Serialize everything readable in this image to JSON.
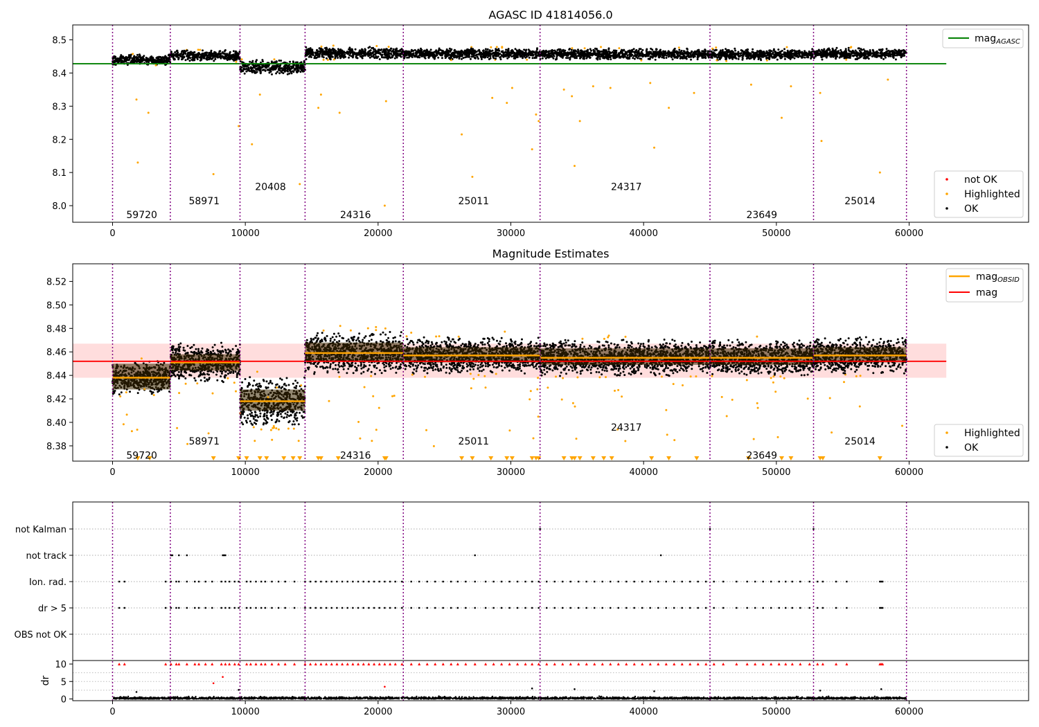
{
  "chart_data": [
    {
      "type": "scatter",
      "title": "AGASC ID 41814056.0",
      "xlabel": "",
      "ylabel": "",
      "xlim": [
        -3000,
        69000
      ],
      "ylim": [
        7.95,
        8.545
      ],
      "xticks": [
        0,
        10000,
        20000,
        30000,
        40000,
        50000,
        60000
      ],
      "yticks": [
        8.0,
        8.1,
        8.2,
        8.3,
        8.4,
        8.5
      ],
      "ytick_labels": [
        "8.0",
        "8.1",
        "8.2",
        "8.3",
        "8.4",
        "8.5"
      ],
      "reference_line": {
        "name": "mag_AGASC",
        "label": "mag",
        "subscript": "AGASC",
        "y": 8.428,
        "x_range": [
          -3000,
          62800
        ],
        "color": "#008000"
      },
      "legend_top": [
        {
          "label": "mag",
          "subscript": "AGASC",
          "color": "#008000",
          "marker": "line"
        }
      ],
      "legend_bottom": [
        {
          "label": "not OK",
          "color": "#ff0000",
          "marker": "dot"
        },
        {
          "label": "Highlighted",
          "color": "#ffa500",
          "marker": "dot"
        },
        {
          "label": "OK",
          "color": "#000000",
          "marker": "dot"
        }
      ],
      "segments": [
        {
          "obsid": "59720",
          "x_start": 0,
          "x_end": 4350,
          "mag_center": 8.44,
          "mag_spread": 0.012,
          "label_x": 2200,
          "label_y": 7.973
        },
        {
          "obsid": "58971",
          "x_start": 4350,
          "x_end": 9600,
          "mag_center": 8.452,
          "mag_spread": 0.013,
          "label_x": 6900,
          "label_y": 8.015
        },
        {
          "obsid": "20408",
          "x_start": 9600,
          "x_end": 14500,
          "mag_center": 8.418,
          "mag_spread": 0.017,
          "label_x": 11900,
          "label_y": 8.058
        },
        {
          "obsid": "24316",
          "x_start": 14500,
          "x_end": 21900,
          "mag_center": 8.46,
          "mag_spread": 0.014,
          "label_x": 18300,
          "label_y": 7.973
        },
        {
          "obsid": "25011",
          "x_start": 21900,
          "x_end": 32200,
          "mag_center": 8.458,
          "mag_spread": 0.013,
          "label_x": 27200,
          "label_y": 8.015
        },
        {
          "obsid": "24317",
          "x_start": 32200,
          "x_end": 45000,
          "mag_center": 8.457,
          "mag_spread": 0.013,
          "label_x": 38700,
          "label_y": 8.058
        },
        {
          "obsid": "23649",
          "x_start": 45000,
          "x_end": 52800,
          "mag_center": 8.456,
          "mag_spread": 0.013,
          "label_x": 48900,
          "label_y": 7.973
        },
        {
          "obsid": "25014",
          "x_start": 52800,
          "x_end": 59800,
          "mag_center": 8.458,
          "mag_spread": 0.013,
          "label_x": 56300,
          "label_y": 8.015
        }
      ],
      "highlighted_outliers": [
        [
          1800,
          8.32
        ],
        [
          1900,
          8.13
        ],
        [
          2700,
          8.28
        ],
        [
          7600,
          8.095
        ],
        [
          9500,
          8.24
        ],
        [
          10500,
          8.185
        ],
        [
          11100,
          8.335
        ],
        [
          14100,
          8.065
        ],
        [
          15500,
          8.295
        ],
        [
          15700,
          8.335
        ],
        [
          17100,
          8.28
        ],
        [
          20600,
          8.315
        ],
        [
          20500,
          8.0
        ],
        [
          26300,
          8.215
        ],
        [
          27100,
          8.087
        ],
        [
          28600,
          8.325
        ],
        [
          29700,
          8.31
        ],
        [
          30100,
          8.355
        ],
        [
          31600,
          8.17
        ],
        [
          31900,
          8.275
        ],
        [
          32100,
          8.255
        ],
        [
          34000,
          8.35
        ],
        [
          34600,
          8.33
        ],
        [
          34800,
          8.12
        ],
        [
          35200,
          8.255
        ],
        [
          36200,
          8.36
        ],
        [
          37500,
          8.355
        ],
        [
          40500,
          8.37
        ],
        [
          40800,
          8.175
        ],
        [
          41900,
          8.295
        ],
        [
          43800,
          8.34
        ],
        [
          48100,
          8.365
        ],
        [
          50400,
          8.265
        ],
        [
          51100,
          8.36
        ],
        [
          53300,
          8.34
        ],
        [
          53400,
          8.195
        ],
        [
          57800,
          8.1
        ],
        [
          58400,
          8.38
        ]
      ]
    },
    {
      "type": "scatter",
      "title": "Magnitude Estimates",
      "xlabel": "",
      "ylabel": "",
      "xlim": [
        -3000,
        69000
      ],
      "ylim": [
        8.367,
        8.535
      ],
      "xticks": [
        0,
        10000,
        20000,
        30000,
        40000,
        50000,
        60000
      ],
      "yticks": [
        8.38,
        8.4,
        8.42,
        8.44,
        8.46,
        8.48,
        8.5,
        8.52
      ],
      "ytick_labels": [
        "8.38",
        "8.40",
        "8.42",
        "8.44",
        "8.46",
        "8.48",
        "8.50",
        "8.52"
      ],
      "mag_line": {
        "y": 8.452,
        "band": [
          8.438,
          8.467
        ],
        "x_range": [
          -3000,
          62800
        ],
        "color": "#ff0000",
        "band_color": "#ffdddd"
      },
      "mag_obsid": [
        {
          "x_start": 0,
          "x_end": 4350,
          "mag": 8.438,
          "band": [
            8.428,
            8.45
          ]
        },
        {
          "x_start": 4350,
          "x_end": 9600,
          "mag": 8.451,
          "band": [
            8.444,
            8.458
          ]
        },
        {
          "x_start": 9600,
          "x_end": 14500,
          "mag": 8.418,
          "band": [
            8.41,
            8.428
          ]
        },
        {
          "x_start": 14500,
          "x_end": 21900,
          "mag": 8.459,
          "band": [
            8.452,
            8.468
          ]
        },
        {
          "x_start": 21900,
          "x_end": 32200,
          "mag": 8.457,
          "band": [
            8.451,
            8.464
          ]
        },
        {
          "x_start": 32200,
          "x_end": 45000,
          "mag": 8.455,
          "band": [
            8.449,
            8.463
          ]
        },
        {
          "x_start": 45000,
          "x_end": 52800,
          "mag": 8.455,
          "band": [
            8.449,
            8.463
          ]
        },
        {
          "x_start": 52800,
          "x_end": 59800,
          "mag": 8.457,
          "band": [
            8.451,
            8.464
          ]
        }
      ],
      "legend_top": [
        {
          "label": "mag",
          "subscript": "OBSID",
          "color": "#ffa500",
          "marker": "line"
        },
        {
          "label": "mag",
          "subscript": "",
          "color": "#ff0000",
          "marker": "line"
        }
      ],
      "legend_bottom": [
        {
          "label": "Highlighted",
          "color": "#ffa500",
          "marker": "dot"
        },
        {
          "label": "OK",
          "color": "#000000",
          "marker": "dot"
        }
      ],
      "obsid_labels": [
        {
          "obsid": "59720",
          "label_x": 2200,
          "label_y": 8.372
        },
        {
          "obsid": "58971",
          "label_x": 6900,
          "label_y": 8.384
        },
        {
          "obsid": "24316",
          "label_x": 18300,
          "label_y": 8.372
        },
        {
          "obsid": "25011",
          "label_x": 27200,
          "label_y": 8.384
        },
        {
          "obsid": "24317",
          "label_x": 38700,
          "label_y": 8.396
        },
        {
          "obsid": "23649",
          "label_x": 48900,
          "label_y": 8.372
        },
        {
          "obsid": "25014",
          "label_x": 56300,
          "label_y": 8.384
        }
      ],
      "off_scale_markers_x": [
        1900,
        2800,
        7600,
        9500,
        10100,
        11100,
        11600,
        12900,
        13600,
        14100,
        15500,
        15700,
        17000,
        20500,
        20600,
        26300,
        27100,
        28500,
        29700,
        30100,
        31600,
        31900,
        32100,
        34000,
        34600,
        34800,
        35200,
        36200,
        37000,
        37600,
        40600,
        41900,
        44000,
        47900,
        50400,
        51100,
        53300,
        53500,
        57800
      ]
    },
    {
      "type": "scatter",
      "title": "",
      "xlabel": "",
      "xlim": [
        -3000,
        69000
      ],
      "xticks": [
        0,
        10000,
        20000,
        30000,
        40000,
        50000,
        60000
      ],
      "flag_rows": [
        "not Kalman",
        "not track",
        "Ion. rad.",
        "dr > 5",
        "OBS not OK"
      ],
      "flag_not_kalman_x": [
        32200,
        45000,
        52800
      ],
      "flag_not_track_x": [
        4400,
        4500,
        5000,
        5600,
        8300,
        8400,
        8500,
        27300,
        41300
      ],
      "flag_ionrad_x": [
        500,
        900,
        4000,
        4400,
        4800,
        5000,
        5600,
        6200,
        6500,
        7000,
        7500,
        8200,
        8500,
        8800,
        9200,
        9500,
        10100,
        10400,
        10800,
        11200,
        11500,
        12000,
        12500,
        13000,
        13700,
        14500,
        14900,
        15300,
        15700,
        16100,
        16500,
        16900,
        17300,
        17700,
        18100,
        18500,
        18900,
        19300,
        19700,
        20100,
        20500,
        20900,
        21300,
        21800,
        22500,
        23100,
        23700,
        24300,
        24900,
        25500,
        26000,
        26600,
        27300,
        28100,
        28700,
        29300,
        29900,
        30500,
        31100,
        31600,
        32100,
        32700,
        33300,
        33900,
        34500,
        35100,
        35700,
        36300,
        36900,
        37500,
        38100,
        38700,
        39300,
        39900,
        40500,
        41100,
        41700,
        42300,
        42900,
        43500,
        44100,
        44700,
        45300,
        46000,
        47000,
        47800,
        48400,
        49000,
        49600,
        50200,
        50700,
        51200,
        51800,
        52500,
        53100,
        53500,
        54500,
        55300,
        57800,
        57900,
        58000
      ],
      "dr_ylabel": "dr",
      "dr_ylim": [
        -0.5,
        11
      ],
      "dr_yticks": [
        0,
        5,
        10
      ],
      "dr_capped_value": 10,
      "dr_outliers": [
        [
          1800,
          2.0
        ],
        [
          7600,
          4.5
        ],
        [
          8300,
          6.3
        ],
        [
          9500,
          2.6
        ],
        [
          20500,
          3.5
        ],
        [
          31600,
          3.0
        ],
        [
          34800,
          2.8
        ],
        [
          40800,
          2.2
        ],
        [
          53300,
          2.4
        ],
        [
          57900,
          2.8
        ]
      ]
    }
  ]
}
